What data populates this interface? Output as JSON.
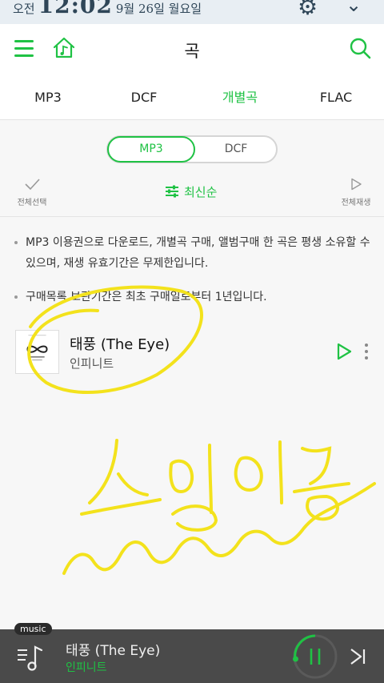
{
  "status_bar": {
    "ampm": "오전",
    "time": "12:02",
    "date": "9월 26일 월요일",
    "settings_icon": "gear-icon",
    "expand_icon": "chevron-down-icon"
  },
  "header": {
    "title": "곡",
    "menu_icon": "hamburger-icon",
    "home_icon": "music-home-icon",
    "search_icon": "search-icon"
  },
  "tabs": [
    {
      "label": "MP3",
      "active": false
    },
    {
      "label": "DCF",
      "active": false
    },
    {
      "label": "개별곡",
      "active": true
    },
    {
      "label": "FLAC",
      "active": false
    }
  ],
  "segment": {
    "selected": "MP3",
    "other": "DCF"
  },
  "toolbar": {
    "select_all": "전체선택",
    "sort": "최신순",
    "play_all": "전체재생"
  },
  "notes": [
    "MP3 이용권으로 다운로드, 개별곡 구매, 앨범구매 한 곡은 평생 소유할 수 있으며, 재생 유효기간은 무제한입니다.",
    "구매목록 보관기간은 최초 구매일로부터 1년입니다."
  ],
  "song": {
    "title": "태풍 (The Eye)",
    "artist": "인피니트"
  },
  "handwriting": "스밍인증",
  "player": {
    "badge": "music",
    "title": "태풍 (The Eye)",
    "artist": "인피니트"
  },
  "colors": {
    "accent": "#1fc244",
    "highlighter": "#f3e21c",
    "player_bg": "#4a4a4a"
  }
}
